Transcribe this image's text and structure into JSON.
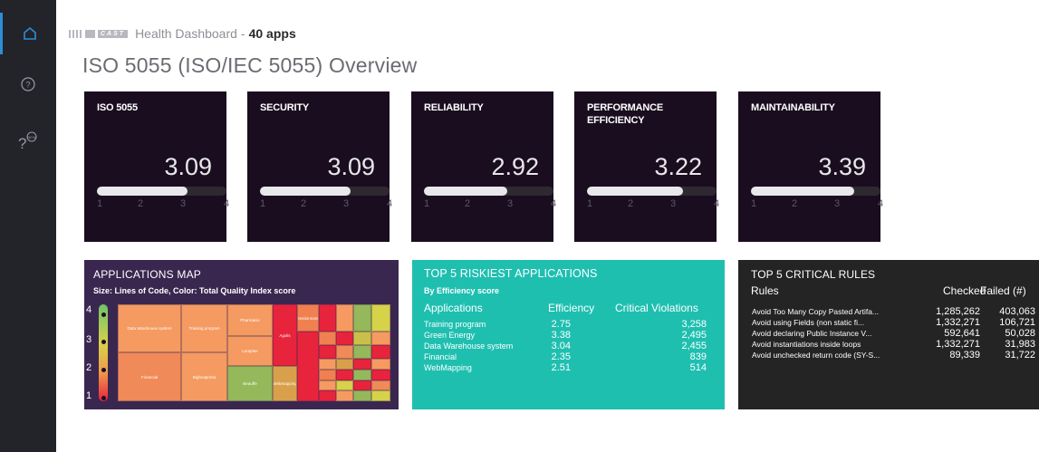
{
  "sidebar": {
    "items": [
      {
        "icon": "home-icon",
        "active": true
      },
      {
        "icon": "help-icon",
        "active": false
      },
      {
        "icon": "whats-new-icon",
        "active": false
      }
    ]
  },
  "header": {
    "logo_word": "CAST",
    "title": "Health Dashboard",
    "separator": "-",
    "apps": "40 apps"
  },
  "page_title": "ISO 5055 (ISO/IEC 5055) Overview",
  "tiles": [
    {
      "title": "ISO 5055",
      "score": "3.09",
      "level": 3.09
    },
    {
      "title": "SECURITY",
      "score": "3.09",
      "level": 3.09
    },
    {
      "title": "RELIABILITY",
      "score": "2.92",
      "level": 2.92
    },
    {
      "title": "PERFORMANCE EFFICIENCY",
      "score": "3.22",
      "level": 3.22
    },
    {
      "title": "MAINTAINABILITY",
      "score": "3.39",
      "level": 3.39
    }
  ],
  "tick_labels": [
    "1",
    "2",
    "3",
    "4"
  ],
  "applications_map": {
    "title": "APPLICATIONS MAP",
    "subtitle": "Size: Lines of Code, Color: Total Quality Index score",
    "scale_labels": [
      "4",
      "3",
      "2",
      "1"
    ],
    "cells": [
      {
        "label": "Data Warehouse system",
        "color": "#f59a60"
      },
      {
        "label": "Training program",
        "color": "#f59a60"
      },
      {
        "label": "Financial",
        "color": "#f08a58"
      },
      {
        "label": "Bigfootprinta",
        "color": "#f59a60"
      },
      {
        "label": "Pharmacie",
        "color": "#f59a60"
      },
      {
        "label": "Lorapine",
        "color": "#f59a60"
      },
      {
        "label": "Beauffe",
        "color": "#94b85a"
      },
      {
        "label": "Agolis",
        "color": "#e8233c"
      },
      {
        "label": "Webmapping",
        "color": "#d8a04a"
      },
      {
        "label": "Gestionnaire",
        "color": "#f08050"
      }
    ]
  },
  "riskiest": {
    "title": "TOP 5 RISKIEST APPLICATIONS",
    "subtitle": "By Efficiency score",
    "headers": {
      "app": "Applications",
      "eff": "Efficiency",
      "viol": "Critical Violations"
    },
    "rows": [
      {
        "app": "Training program",
        "eff": "2.75",
        "viol": "3,258"
      },
      {
        "app": "Green Energy",
        "eff": "3.38",
        "viol": "2,495"
      },
      {
        "app": "Data Warehouse system",
        "eff": "3.04",
        "viol": "2,455"
      },
      {
        "app": "Financial",
        "eff": "2.35",
        "viol": "839"
      },
      {
        "app": "WebMapping",
        "eff": "2.51",
        "viol": "514"
      }
    ]
  },
  "critical_rules": {
    "title": "TOP 5 CRITICAL RULES",
    "headers": {
      "rule": "Rules",
      "checked": "Checked",
      "failed": "Failed (#)"
    },
    "rows": [
      {
        "rule": "Avoid Too Many Copy Pasted Artifa...",
        "checked": "1,285,262",
        "failed": "403,063"
      },
      {
        "rule": "Avoid using Fields (non static fi...",
        "checked": "1,332,271",
        "failed": "106,721"
      },
      {
        "rule": "Avoid declaring Public Instance V...",
        "checked": "592,641",
        "failed": "50,028"
      },
      {
        "rule": "Avoid instantiations inside loops",
        "checked": "1,332,271",
        "failed": "31,983"
      },
      {
        "rule": "Avoid unchecked return code (SY-S...",
        "checked": "89,339",
        "failed": "31,722"
      }
    ]
  }
}
